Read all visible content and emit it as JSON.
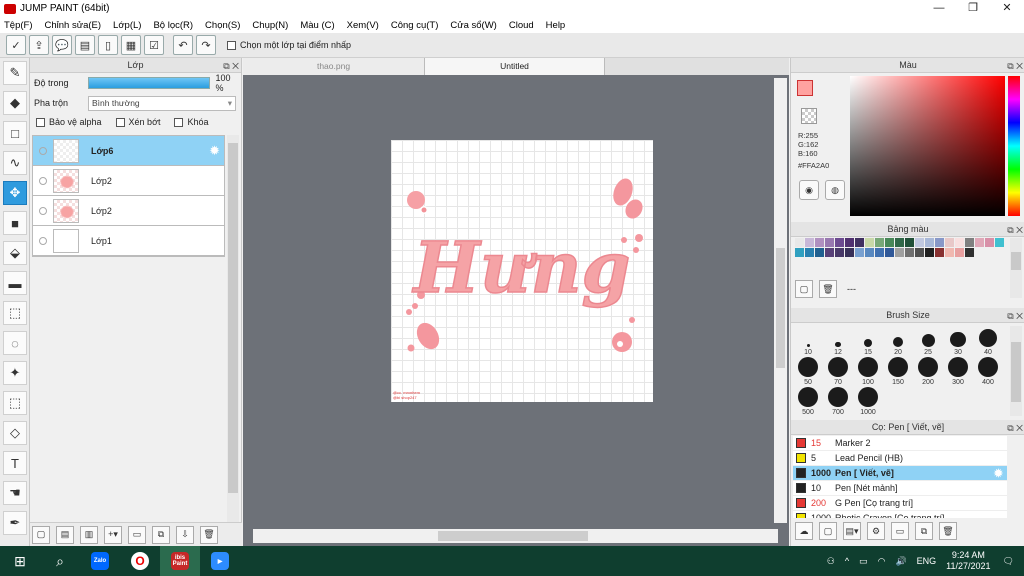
{
  "window": {
    "title": "JUMP PAINT (64bit)",
    "min": "—",
    "max": "❐",
    "close": "✕"
  },
  "menu": [
    "Tệp(F)",
    "Chỉnh sửa(E)",
    "Lớp(L)",
    "Bộ lọc(R)",
    "Chọn(S)",
    "Chụp(N)",
    "Màu (C)",
    "Xem(V)",
    "Công cụ(T)",
    "Cửa sổ(W)",
    "Cloud",
    "Help"
  ],
  "toolbar": {
    "checkbox_label": "Chọn một lớp tại điểm nhấp"
  },
  "layer_panel": {
    "title": "Lớp",
    "opacity_label": "Độ trong",
    "opacity_value": "100 %",
    "opacity": 1.0,
    "blend_label": "Pha trộn",
    "blend_value": "Bình thường",
    "protect_alpha": "Bảo vệ alpha",
    "clip": "Xén bớt",
    "lock": "Khóa",
    "layers": [
      {
        "name": "Lớp6",
        "selected": true
      },
      {
        "name": "Lớp2",
        "selected": false
      },
      {
        "name": "Lớp2",
        "selected": false
      },
      {
        "name": "Lớp1",
        "selected": false
      }
    ]
  },
  "canvas": {
    "tabs": [
      "thao.png",
      "Untitled"
    ],
    "active_tab": "Untitled",
    "artwork_text": "Hưng",
    "watermark": "@cc. mrxnhem\n@bi shop247"
  },
  "color_panel": {
    "title": "Màu",
    "r": "R:255",
    "g": "G:162",
    "b": "B:160",
    "hex": "#FFA2A0",
    "foreground": "#FFA2A0"
  },
  "palette_panel": {
    "title": "Bảng màu",
    "dash": "---",
    "colors": [
      "#e8e8e8",
      "#c8b8d8",
      "#b090c0",
      "#9878b0",
      "#6c4a90",
      "#503070",
      "#403060",
      "#c8d8a8",
      "#78a878",
      "#488858",
      "#306848",
      "#205038",
      "#c0c8e0",
      "#a8b8d8",
      "#8898c8",
      "#e8c8c8",
      "#f8e0e0",
      "#808080",
      "#e0a8b8",
      "#d890a8",
      "#40c0d0",
      "#30a0c0",
      "#2880b0",
      "#206090",
      "#584078",
      "#483868",
      "#383058",
      "#78a0d0",
      "#5888c0",
      "#4070b0",
      "#305898",
      "#a0a0a0",
      "#707070",
      "#505050",
      "#202020",
      "#883030",
      "#f0b8b0",
      "#e8a0a0",
      "#303030"
    ]
  },
  "brush_size_panel": {
    "title": "Brush Size",
    "sizes": [
      "10",
      "12",
      "15",
      "20",
      "25",
      "30",
      "40",
      "50",
      "70",
      "100",
      "150",
      "200",
      "300",
      "400",
      "500",
      "700",
      "1000"
    ]
  },
  "brush_panel": {
    "title": "Cọ: Pen [ Viết, vẽ]",
    "brushes": [
      {
        "size": "15",
        "name": "Marker 2",
        "color": "#e53935",
        "selected": false
      },
      {
        "size": "5",
        "name": "Lead Pencil (HB)",
        "color": "#f2e400",
        "selected": false
      },
      {
        "size": "1000",
        "name": "Pen [ Viết, vẽ]",
        "color": "#222222",
        "selected": true
      },
      {
        "size": "10",
        "name": "Pen [Nét mảnh]",
        "color": "#222222",
        "selected": false
      },
      {
        "size": "200",
        "name": "G Pen [Cọ trang trí]",
        "color": "#e53935",
        "selected": false
      },
      {
        "size": "1000",
        "name": "Rhotic Crayon [Cọ trang trí]",
        "color": "#f2e400",
        "selected": false
      }
    ]
  },
  "taskbar": {
    "lang": "ENG",
    "time": "9:24 AM",
    "date": "11/27/2021",
    "zalo": "Zalo",
    "ibis": "ibis\nPaint"
  }
}
